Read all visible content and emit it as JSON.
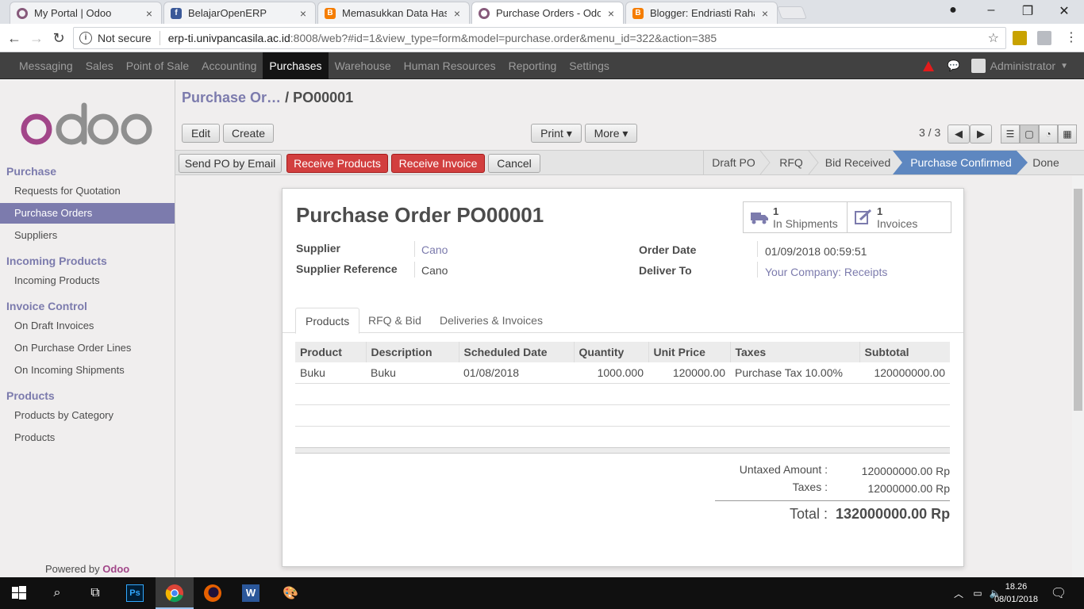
{
  "browser": {
    "tabs": [
      {
        "title": "My Portal | Odoo",
        "icon": "odoo-icon"
      },
      {
        "title": "BelajarOpenERP",
        "icon": "facebook-icon"
      },
      {
        "title": "Memasukkan Data Hasil",
        "icon": "blogger-icon"
      },
      {
        "title": "Purchase Orders - Odoo",
        "icon": "odoo-icon"
      },
      {
        "title": "Blogger: Endriasti Rahayu",
        "icon": "blogger-icon"
      }
    ],
    "security_label": "Not secure",
    "url_host": "erp-ti.univpancasila.ac.id",
    "url_rest": ":8008/web?#id=1&view_type=form&model=purchase.order&menu_id=322&action=385"
  },
  "topmenu": {
    "items": [
      "Messaging",
      "Sales",
      "Point of Sale",
      "Accounting",
      "Purchases",
      "Warehouse",
      "Human Resources",
      "Reporting",
      "Settings"
    ],
    "active": "Purchases",
    "user": "Administrator"
  },
  "sidebar": {
    "sections": [
      {
        "title": "Purchase",
        "items": [
          "Requests for Quotation",
          "Purchase Orders",
          "Suppliers"
        ]
      },
      {
        "title": "Incoming Products",
        "items": [
          "Incoming Products"
        ]
      },
      {
        "title": "Invoice Control",
        "items": [
          "On Draft Invoices",
          "On Purchase Order Lines",
          "On Incoming Shipments"
        ]
      },
      {
        "title": "Products",
        "items": [
          "Products by Category",
          "Products"
        ]
      }
    ],
    "active_item": "Purchase Orders",
    "powered_by": "Powered by",
    "powered_brand": "Odoo"
  },
  "breadcrumb": {
    "parent": "Purchase Or…",
    "separator": "/",
    "current": "PO00001"
  },
  "toolbar": {
    "edit": "Edit",
    "create": "Create",
    "print": "Print ▾",
    "more": "More ▾",
    "pager": "3 / 3"
  },
  "status": {
    "buttons": [
      "Send PO by Email",
      "Receive Products",
      "Receive Invoice",
      "Cancel"
    ],
    "stages": [
      "Draft PO",
      "RFQ",
      "Bid Received",
      "Purchase Confirmed",
      "Done"
    ],
    "active_stage": "Purchase Confirmed"
  },
  "form": {
    "title_prefix": "Purchase Order",
    "title_number": "PO00001",
    "smart_buttons": [
      {
        "count": "1",
        "label": "In Shipments",
        "icon": "truck-icon"
      },
      {
        "count": "1",
        "label": "Invoices",
        "icon": "edit-icon"
      }
    ],
    "fields": {
      "supplier_label": "Supplier",
      "supplier": "Cano",
      "supplier_ref_label": "Supplier Reference",
      "supplier_ref": "Cano",
      "order_date_label": "Order Date",
      "order_date": "01/09/2018 00:59:51",
      "deliver_to_label": "Deliver To",
      "deliver_to": "Your Company: Receipts"
    },
    "tabs": [
      "Products",
      "RFQ & Bid",
      "Deliveries & Invoices"
    ],
    "table": {
      "headers": [
        "Product",
        "Description",
        "Scheduled Date",
        "Quantity",
        "Unit Price",
        "Taxes",
        "Subtotal"
      ],
      "rows": [
        [
          "Buku",
          "Buku",
          "01/08/2018",
          "1000.000",
          "120000.00",
          "Purchase Tax 10.00%",
          "120000000.00"
        ]
      ]
    },
    "totals": {
      "untaxed_label": "Untaxed Amount :",
      "untaxed": "120000000.00 Rp",
      "taxes_label": "Taxes :",
      "taxes": "12000000.00 Rp",
      "total_label": "Total :",
      "total": "132000000.00 Rp"
    }
  },
  "taskbar": {
    "time": "18.26",
    "date": "08/01/2018"
  }
}
